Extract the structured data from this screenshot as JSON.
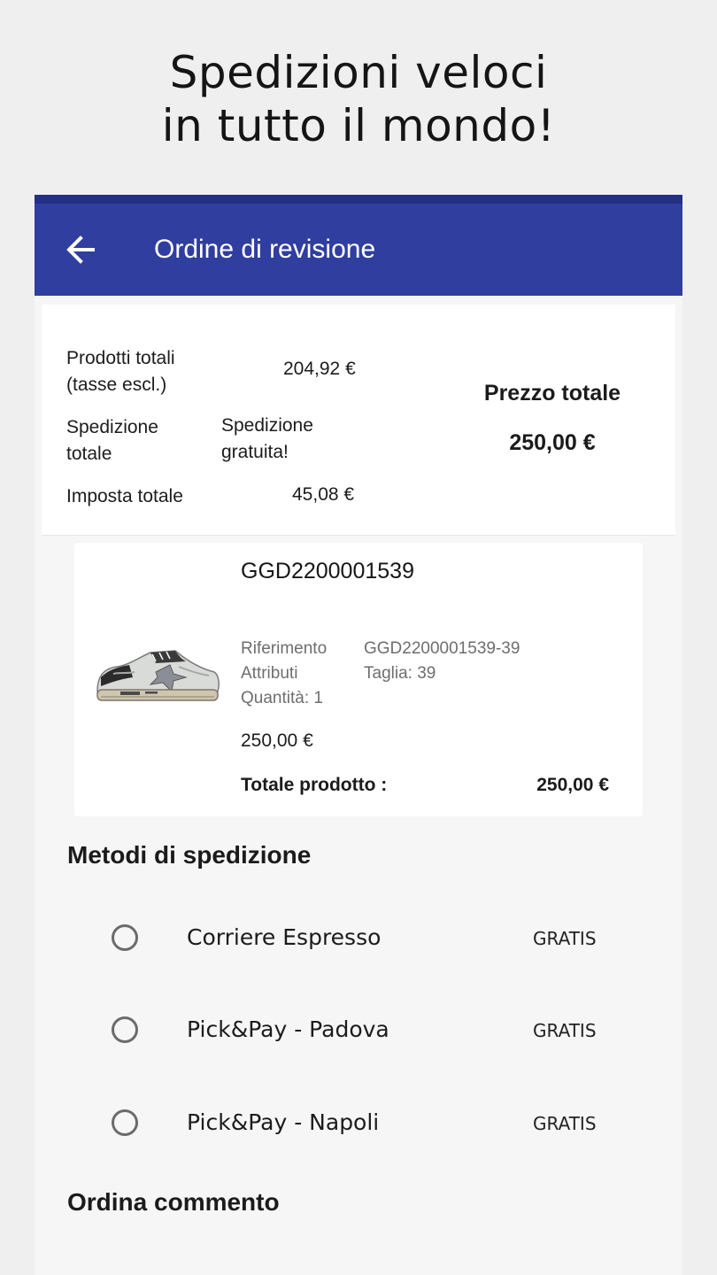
{
  "promo": {
    "line1": "Spedizioni veloci",
    "line2": "in tutto il mondo!"
  },
  "appbar": {
    "title": "Ordine di revisione",
    "back_icon": "arrow-left-icon",
    "color": "#303ea0"
  },
  "summary": {
    "products_label": "Prodotti totali (tasse escl.)",
    "products_value": "204,92 €",
    "shipping_label": "Spedizione totale",
    "shipping_value": "Spedizione gratuita!",
    "tax_label": "Imposta totale",
    "tax_value": "45,08 €",
    "total_label": "Prezzo totale",
    "total_value": "250,00 €"
  },
  "product": {
    "code": "GGD2200001539",
    "reference_label": "Riferimento",
    "reference_value": "GGD2200001539-39",
    "attributes_label": "Attributi",
    "attributes_value": "Taglia: 39",
    "quantity": "Quantità: 1",
    "price": "250,00 €",
    "total_label": "Totale prodotto :",
    "total_value": "250,00 €",
    "image_icon": "sneaker-image"
  },
  "shipping": {
    "title": "Metodi di spedizione",
    "methods": [
      {
        "name": "Corriere Espresso",
        "price": "GRATIS"
      },
      {
        "name": "Pick&Pay - Padova",
        "price": "GRATIS"
      },
      {
        "name": "Pick&Pay - Napoli",
        "price": "GRATIS"
      }
    ]
  },
  "comment": {
    "title": "Ordina commento"
  }
}
